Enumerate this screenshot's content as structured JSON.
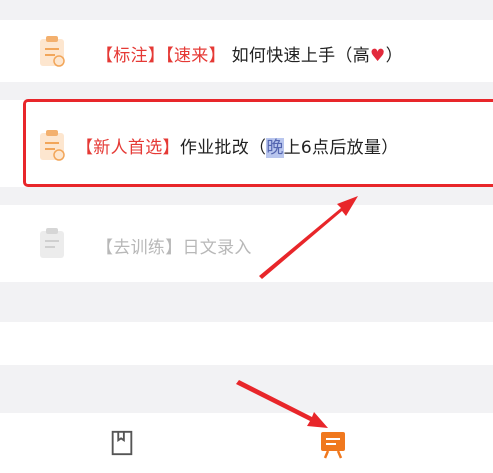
{
  "tasks": [
    {
      "tag": "【标注】【速来】",
      "title": "如何快速上手（高",
      "heart": "♥",
      "close": "）",
      "icon": "clipboard-icon"
    },
    {
      "tag": "【新人首选】",
      "title": "作业批改（",
      "highlight": "晚",
      "rest": "上6点后放量）",
      "icon": "clipboard-icon"
    },
    {
      "title": "【去训练】日文录入",
      "icon": "clipboard-icon"
    }
  ],
  "colors": {
    "accent_red": "#e53935",
    "orange": "#f0781e",
    "background": "#f2f2f4"
  },
  "bottom_nav": [
    {
      "icon": "book-icon",
      "active": false
    },
    {
      "icon": "task-board-icon",
      "active": true
    }
  ]
}
